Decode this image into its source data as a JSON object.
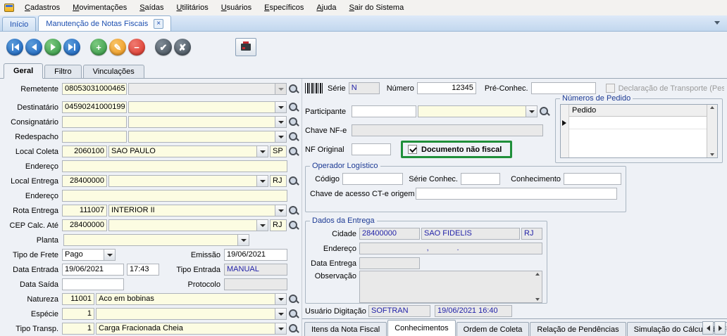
{
  "menubar": {
    "items": [
      "Cadastros",
      "Movimentações",
      "Saídas",
      "Utilitários",
      "Usuários",
      "Específicos",
      "Ajuda",
      "Sair do Sistema"
    ]
  },
  "tabbar": {
    "home": "Início",
    "active": "Manutenção de Notas Fiscais",
    "close_glyph": "×"
  },
  "toolbar": {
    "add_glyph": "+",
    "edit_glyph": "✎",
    "delete_glyph": "−",
    "confirm_glyph": "✔",
    "cancel_glyph": "✘"
  },
  "subtabs": {
    "geral": "Geral",
    "filtro": "Filtro",
    "vinculacoes": "Vinculações"
  },
  "left": {
    "remetente": {
      "label": "Remetente",
      "code": "08053031000465",
      "name": ""
    },
    "destinatario": {
      "label": "Destinatário",
      "code": "04590241000199",
      "name": ""
    },
    "consignatario": {
      "label": "Consignatário",
      "code": "",
      "name": ""
    },
    "redespacho": {
      "label": "Redespacho",
      "code": "",
      "name": ""
    },
    "local_coleta": {
      "label": "Local Coleta",
      "code": "2060100",
      "name": "SAO PAULO",
      "uf": "SP"
    },
    "endereco_coleta": {
      "label": "Endereço",
      "value": ""
    },
    "local_entrega": {
      "label": "Local Entrega",
      "code": "28400000",
      "name": "",
      "uf": "RJ"
    },
    "endereco_entrega": {
      "label": "Endereço",
      "value": ""
    },
    "rota_entrega": {
      "label": "Rota Entrega",
      "code": "111007",
      "name": "INTERIOR II"
    },
    "cep_calc_ate": {
      "label": "CEP Calc. Até",
      "code": "28400000",
      "name": "",
      "uf": "RJ"
    },
    "planta": {
      "label": "Planta",
      "name": ""
    },
    "tipo_frete": {
      "label": "Tipo de Frete",
      "value": "Pago"
    },
    "emissao": {
      "label": "Emissão",
      "value": "19/06/2021"
    },
    "data_entrada": {
      "label": "Data Entrada",
      "date": "19/06/2021",
      "time": "17:43"
    },
    "tipo_entrada": {
      "label": "Tipo Entrada",
      "value": "MANUAL"
    },
    "data_saida": {
      "label": "Data Saída",
      "value": ""
    },
    "protocolo": {
      "label": "Protocolo",
      "value": ""
    },
    "natureza": {
      "label": "Natureza",
      "code": "11001",
      "name": "Aco em bobinas"
    },
    "especie": {
      "label": "Espécie",
      "code": "1",
      "name": ""
    },
    "tipo_transp": {
      "label": "Tipo Transp.",
      "code": "1",
      "name": "Carga Fracionada Cheia"
    }
  },
  "right": {
    "serie": {
      "label": "Série",
      "value": "N"
    },
    "numero": {
      "label": "Número",
      "value": "12345"
    },
    "pre_conhec": {
      "label": "Pré-Conhec.",
      "value": ""
    },
    "decl_transporte": {
      "label": "Declaração de Transporte (Pessoa Física)",
      "checked": false
    },
    "participante": {
      "label": "Participante",
      "code": "",
      "name": ""
    },
    "chave_nfe": {
      "label": "Chave NF-e",
      "value": ""
    },
    "nf_original": {
      "label": "NF Original",
      "value": ""
    },
    "doc_nao_fiscal": {
      "label": "Documento não fiscal",
      "checked": true
    },
    "numeros_pedido": {
      "title": "Números de Pedido",
      "column": "Pedido"
    },
    "operador_logistico": {
      "title": "Operador Logístico",
      "codigo": {
        "label": "Código",
        "value": ""
      },
      "serie_conhec": {
        "label": "Série Conhec.",
        "value": ""
      },
      "conhecimento": {
        "label": "Conhecimento",
        "value": ""
      },
      "chave_cte": {
        "label": "Chave de acesso CT-e origem",
        "value": ""
      }
    },
    "dados_entrega": {
      "title": "Dados da Entrega",
      "cidade": {
        "label": "Cidade",
        "code": "28400000",
        "name": "SAO FIDELIS",
        "uf": "RJ"
      },
      "endereco": {
        "label": "Endereço",
        "value": "                              ,             ."
      },
      "data_entrega": {
        "label": "Data Entrega",
        "value": ""
      },
      "observacao": {
        "label": "Observação",
        "value": ""
      },
      "usuario_digitacao": {
        "label": "Usuário Digitação",
        "user": "SOFTRAN",
        "datetime": "19/06/2021 16:40"
      }
    }
  },
  "bottom_tabs": {
    "items": [
      "Itens da Nota Fiscal",
      "Conhecimentos",
      "Ordem de Coleta",
      "Relação de Pendências",
      "Simulação do Cálculo do Fret"
    ],
    "active": "Conhecimentos"
  }
}
